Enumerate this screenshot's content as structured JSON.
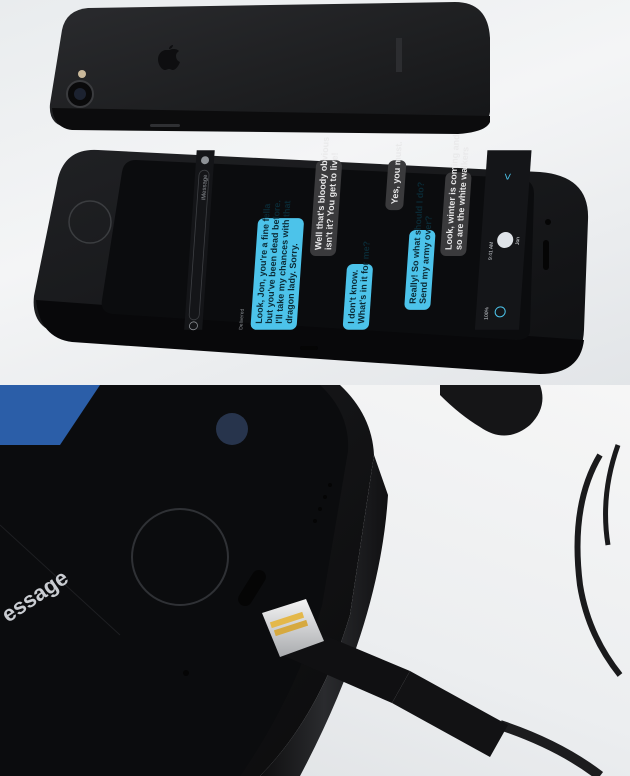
{
  "top_photo": {
    "header": {
      "contact_name": "Jon",
      "time": "9:41 AM",
      "battery": "100%",
      "back_glyph": "<"
    },
    "messages": [
      {
        "side": "received",
        "lines": [
          "Look, winter is coming and",
          "so are the white walkers"
        ]
      },
      {
        "side": "sent",
        "lines": [
          "Really! So what should I do?",
          "Send my army over?"
        ]
      },
      {
        "side": "received",
        "lines": [
          "Yes, you must."
        ]
      },
      {
        "side": "sent",
        "lines": [
          "I don't know.",
          "What's in it for me?"
        ]
      },
      {
        "side": "received",
        "lines": [
          "Well that's bloody obvious",
          "isn't it? You get to live!"
        ]
      },
      {
        "side": "sent",
        "lines": [
          "Look, Jon, you're a fine fella",
          "but you've been dead before.",
          "I'll take my chances with that",
          "dragon lady. Sorry."
        ]
      }
    ],
    "delivered": "Delivered",
    "input_placeholder": "iMessage"
  },
  "bottom_photo": {
    "screen_text": "essage"
  },
  "colors": {
    "sent_bubble": "#4cc3ea",
    "received_bubble": "#3a3a3c",
    "phone_body": "#1c1d1f",
    "screen": "#0b0c0e"
  }
}
